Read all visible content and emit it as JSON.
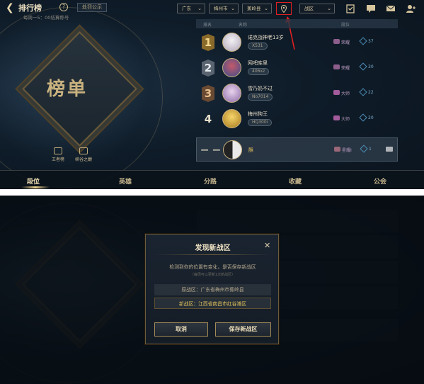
{
  "header": {
    "title": "排行榜",
    "help": "?",
    "notice_button": "处罚公示",
    "subtitle": "每周一5：00结算称号",
    "province": "广东",
    "city": "梅州市",
    "county": "蕉岭县",
    "zone_select": "战区",
    "icons": [
      "back-icon",
      "location-icon",
      "clipboard-icon",
      "chat-icon",
      "mail-icon",
      "friends-icon"
    ]
  },
  "banner": {
    "title": "榜单",
    "badges": [
      "王者榜",
      "峡谷之巅"
    ]
  },
  "list": {
    "columns": [
      "排名",
      "名称",
      "段位"
    ],
    "rows": [
      {
        "rank": "1",
        "name": "诺克战神老13岁",
        "tag": "X531",
        "tier": "荣耀",
        "stars": "37"
      },
      {
        "rank": "2",
        "name": "网吧库里",
        "tag": "406xz",
        "tier": "荣耀",
        "stars": "30"
      },
      {
        "rank": "3",
        "name": "雪乃奶不过",
        "tag": "No7014",
        "tier": "大师",
        "stars": "22"
      },
      {
        "rank": "4",
        "name": "梅州狗王",
        "tag": "HQ300i",
        "tier": "大师",
        "stars": "20"
      }
    ],
    "me": {
      "rank": "— —",
      "name": "酥",
      "tier": "星耀I",
      "stars": "1"
    }
  },
  "tabs": [
    "段位",
    "英雄",
    "分路",
    "收藏",
    "公会"
  ],
  "dialog": {
    "title": "发现新战区",
    "close": "✕",
    "message": "检测到你的位置有变化，是否保存新战区",
    "note": "（每周可以更新1次新战区）",
    "old_zone": "原战区：广东省梅州市蕉岭县",
    "new_zone": "新战区：江西省南昌市红谷滩区",
    "cancel": "取消",
    "save": "保存新战区"
  },
  "colors": {
    "highlight": "#e02020",
    "gold": "#c9b27f",
    "new_zone": "#e2c05c"
  }
}
